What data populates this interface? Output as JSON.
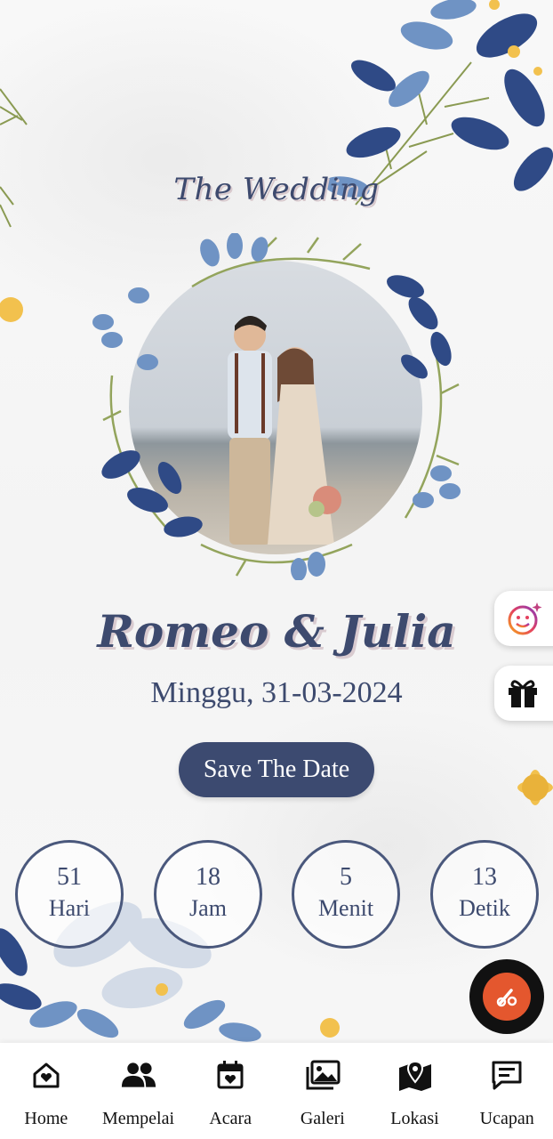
{
  "header": {
    "title": "The Wedding"
  },
  "couple": {
    "names": "Romeo & Julia"
  },
  "event": {
    "date": "Minggu, 31-03-2024"
  },
  "cta": {
    "save_date_label": "Save The Date"
  },
  "countdown": [
    {
      "value": "51",
      "label": "Hari"
    },
    {
      "value": "18",
      "label": "Jam"
    },
    {
      "value": "5",
      "label": "Menit"
    },
    {
      "value": "13",
      "label": "Detik"
    }
  ],
  "side_buttons": [
    {
      "icon": "face-filter-icon"
    },
    {
      "icon": "gift-icon"
    }
  ],
  "music_button": {
    "icon": "music-disc-icon",
    "color": "#e4572e"
  },
  "bottom_nav": [
    {
      "label": "Home",
      "icon": "home-heart-icon"
    },
    {
      "label": "Mempelai",
      "icon": "people-icon"
    },
    {
      "label": "Acara",
      "icon": "calendar-heart-icon"
    },
    {
      "label": "Galeri",
      "icon": "gallery-icon"
    },
    {
      "label": "Lokasi",
      "icon": "map-pin-icon"
    },
    {
      "label": "Ucapan",
      "icon": "message-icon"
    }
  ],
  "theme": {
    "primary": "#3c4a70",
    "accent_leaf_dark": "#2f4a86",
    "accent_leaf_light": "#7fa0c8",
    "accent_flower": "#f2c14e"
  }
}
